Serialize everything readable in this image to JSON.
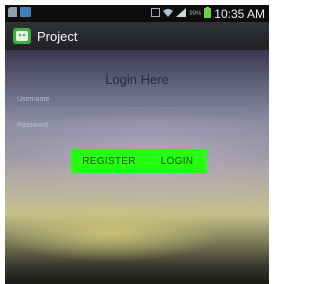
{
  "status_bar": {
    "battery_percent_label": "99%",
    "time": "10:35 AM"
  },
  "action_bar": {
    "title": "Project"
  },
  "login": {
    "heading": "Login Here",
    "username_placeholder": "Username",
    "password_placeholder": "Password",
    "register_label": "REGISTER",
    "login_label": "LOGIN"
  },
  "colors": {
    "button_green": "#22ff11",
    "app_icon_green": "#3cb043"
  }
}
